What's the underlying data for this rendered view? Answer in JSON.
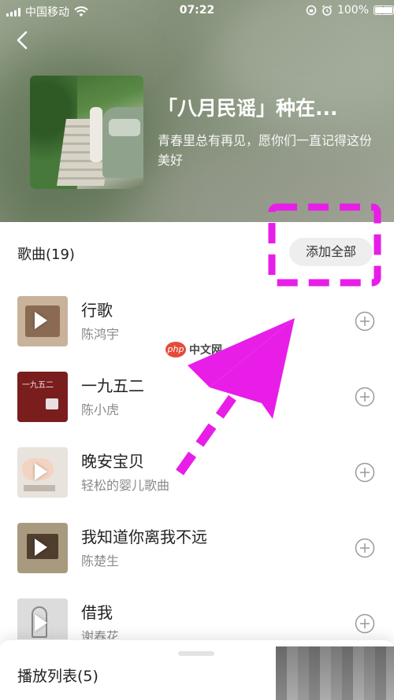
{
  "status_bar": {
    "carrier": "中国移动",
    "time": "07:22",
    "battery": "100%",
    "battery_level": 1.0
  },
  "album": {
    "title": "「八月民谣」种在...",
    "description": "青春里总有再见，愿你们一直记得这份美好"
  },
  "songs_section": {
    "title": "歌曲(19)",
    "add_all_label": "添加全部"
  },
  "songs": [
    {
      "title": "行歌",
      "artist": "陈鸿宇"
    },
    {
      "title": "一九五二",
      "artist": "陈小虎",
      "cover_text": "一九五二"
    },
    {
      "title": "晚安宝贝",
      "artist": "轻松的婴儿歌曲"
    },
    {
      "title": "我知道你离我不远",
      "artist": "陈楚生"
    },
    {
      "title": "借我",
      "artist": "谢春花"
    }
  ],
  "bottom_bar": {
    "playlist_label": "播放列表(5)"
  },
  "watermark": {
    "badge": "php",
    "text": "中文网"
  },
  "colors": {
    "annotation": "#e81ee8",
    "add_all_bg": "#eeeeef",
    "secondary_text": "#8a8a8a"
  },
  "icons": {
    "back": "chevron-left-icon",
    "add": "plus-circle-icon",
    "play": "play-icon",
    "wifi": "wifi-icon",
    "alarm": "alarm-icon",
    "lock": "rotation-lock-icon",
    "battery": "battery-icon",
    "charging": "charging-bolt-icon"
  }
}
